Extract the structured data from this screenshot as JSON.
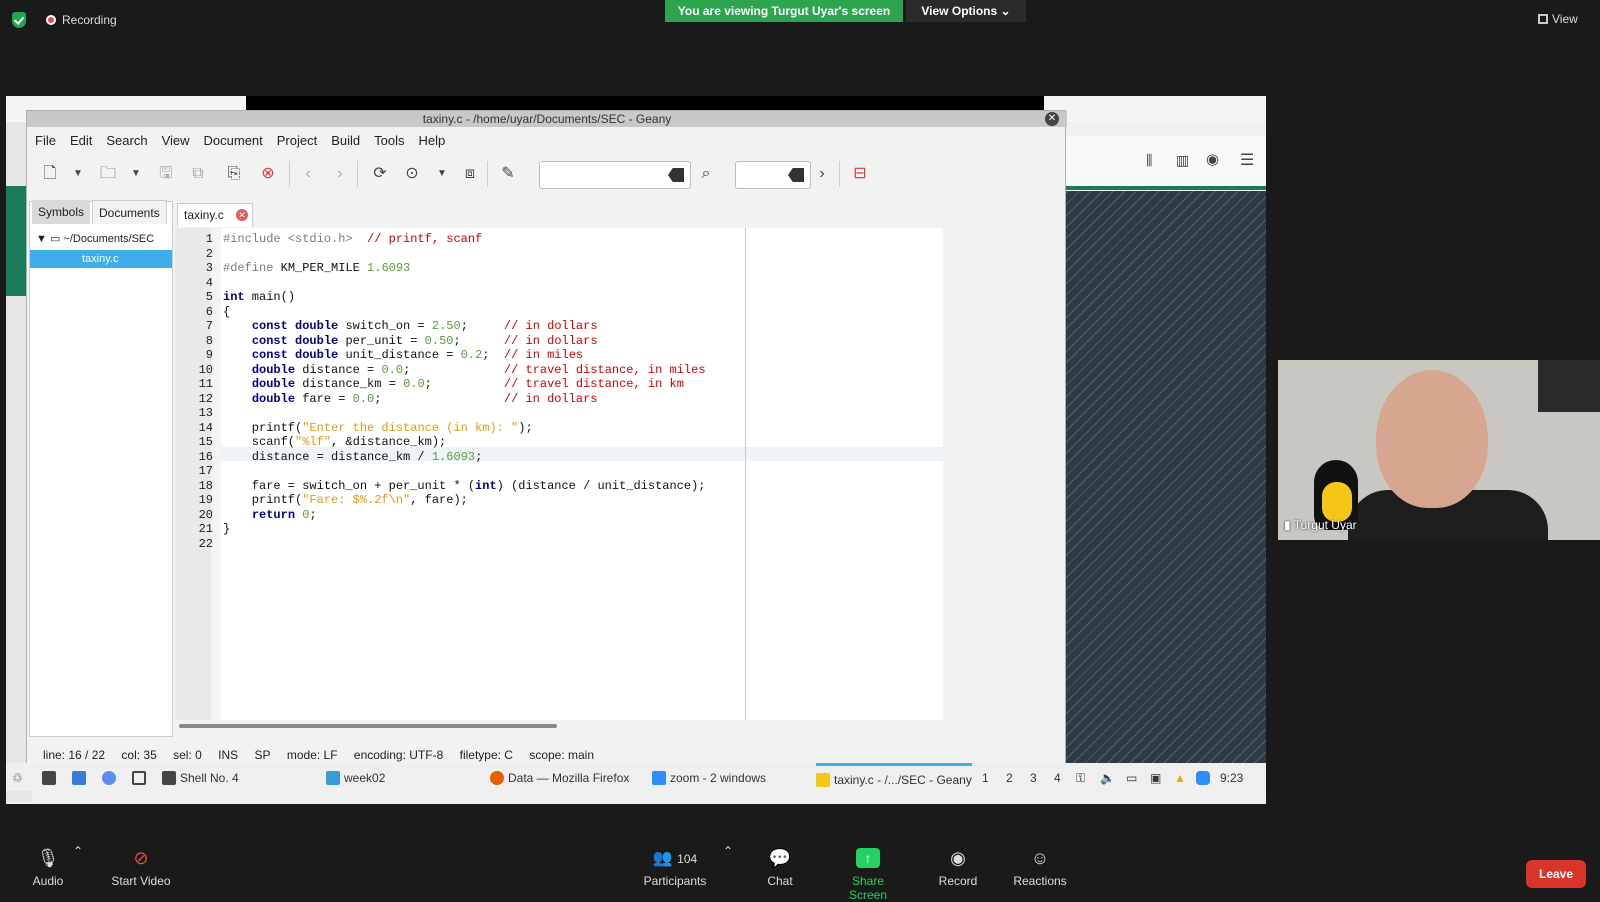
{
  "zoom": {
    "recording_label": "Recording",
    "viewing_banner": "You are viewing Turgut Uyar's screen",
    "view_options": "View Options",
    "view_label": "View",
    "participant_name": "Turgut Uyar",
    "participants_count": "104",
    "bottom": {
      "audio": "Audio",
      "start_video": "Start Video",
      "participants": "Participants",
      "chat": "Chat",
      "share_screen": "Share Screen",
      "record": "Record",
      "reactions": "Reactions",
      "leave": "Leave"
    },
    "colors": {
      "banner": "#2da44e",
      "leave": "#d9342b",
      "share": "#23d160"
    }
  },
  "geany": {
    "title": "taxiny.c - /home/uyar/Documents/SEC - Geany",
    "menu": [
      "File",
      "Edit",
      "Search",
      "View",
      "Document",
      "Project",
      "Build",
      "Tools",
      "Help"
    ],
    "sidebar_tabs": {
      "symbols": "Symbols",
      "documents": "Documents"
    },
    "tree_root": "~/Documents/SEC",
    "tree_file": "taxiny.c",
    "doc_tab": "taxiny.c",
    "status": {
      "line": "line: 16 / 22",
      "col": "col: 35",
      "sel": "sel: 0",
      "ins": "INS",
      "sp": "SP",
      "mode": "mode: LF",
      "encoding": "encoding: UTF-8",
      "filetype": "filetype: C",
      "scope": "scope: main"
    },
    "code_lines": [
      "#include <stdio.h>  // printf, scanf",
      "",
      "#define KM_PER_MILE 1.6093",
      "",
      "int main()",
      "{",
      "    const double switch_on = 2.50;     // in dollars",
      "    const double per_unit = 0.50;      // in dollars",
      "    const double unit_distance = 0.2;  // in miles",
      "    double distance = 0.0;             // travel distance, in miles",
      "    double distance_km = 0.0;          // travel distance, in km",
      "    double fare = 0.0;                 // in dollars",
      "",
      "    printf(\"Enter the distance (in km): \");",
      "    scanf(\"%lf\", &distance_km);",
      "    distance = distance_km / 1.6093;",
      "",
      "    fare = switch_on + per_unit * (int) (distance / unit_distance);",
      "    printf(\"Fare: $%.2f\\n\", fare);",
      "    return 0;",
      "}",
      ""
    ]
  },
  "taskbar": {
    "shell": "Shell No. 4",
    "folder": "week02",
    "firefox": "Data — Mozilla Firefox",
    "zoom": "zoom - 2 windows",
    "geany": "taxiny.c - /.../SEC - Geany",
    "desktops": [
      "1",
      "2",
      "3",
      "4"
    ],
    "clock": "9:23"
  }
}
